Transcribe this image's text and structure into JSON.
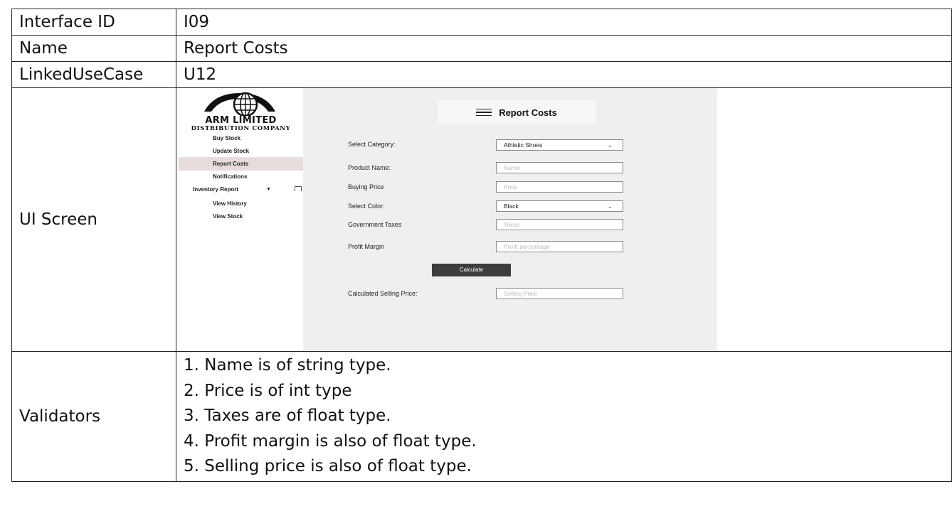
{
  "rows": {
    "interface_id": {
      "label": "Interface ID",
      "value": "I09"
    },
    "name": {
      "label": "Name",
      "value": "Report Costs"
    },
    "linked_use_case": {
      "label": "LinkedUseCase",
      "value": "U12"
    },
    "ui_screen": {
      "label": "UI Screen"
    },
    "validators": {
      "label": "Validators",
      "items": [
        "1. Name is of string type.",
        "2. Price is of int type",
        "3. Taxes are of float type.",
        "4. Profit margin is also of float type.",
        "5. Selling price is also of float type."
      ]
    }
  },
  "screen": {
    "brand": {
      "name": "ARM LIMITED",
      "tagline": "DISTRIBUTION COMPANY"
    },
    "back_icon": "left-arrow-icon",
    "sidebar": [
      {
        "label": "Buy Stock"
      },
      {
        "label": "Update Stock"
      },
      {
        "label": "Report Costs"
      },
      {
        "label": "Notifications"
      },
      {
        "label": "Inventory Report"
      },
      {
        "label": "View History"
      },
      {
        "label": "View Stock"
      }
    ],
    "title": "Report Costs",
    "fields": {
      "category": {
        "label": "Select Category:",
        "value": "Athletic Shoes"
      },
      "product_name": {
        "label": "Product Name:",
        "placeholder": "Name"
      },
      "buying_price": {
        "label": "Buying Price",
        "placeholder": "Price"
      },
      "color": {
        "label": "Select Color:",
        "value": "Black"
      },
      "taxes": {
        "label": "Government Taxes",
        "placeholder": "Taxes"
      },
      "profit": {
        "label": "Profit Margin",
        "placeholder": "Profit percentage"
      },
      "selling_price": {
        "label": "Calculated Selling Price:",
        "placeholder": "Selling Price"
      }
    },
    "calculate_label": "Calculate",
    "colors": {
      "active_nav": "#e6dcdc",
      "button": "#3d3d3d",
      "main_bg": "#efefef"
    }
  }
}
